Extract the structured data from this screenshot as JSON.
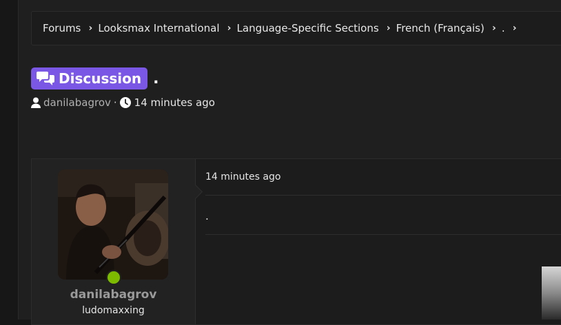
{
  "breadcrumb": {
    "items": [
      {
        "label": "Forums"
      },
      {
        "label": "Looksmax International"
      },
      {
        "label": "Language-Specific Sections"
      },
      {
        "label": "French (Français)"
      },
      {
        "label": "."
      }
    ]
  },
  "thread": {
    "prefix": "Discussion",
    "title": ".",
    "prefix_color": "#7b57e6",
    "author": "danilabagrov",
    "separator": "·",
    "time": "14 minutes ago"
  },
  "post": {
    "time": "14 minutes ago",
    "content": ".",
    "username": "danilabagrov",
    "user_title": "ludomaxxing",
    "online_color": "#7dbb00"
  }
}
